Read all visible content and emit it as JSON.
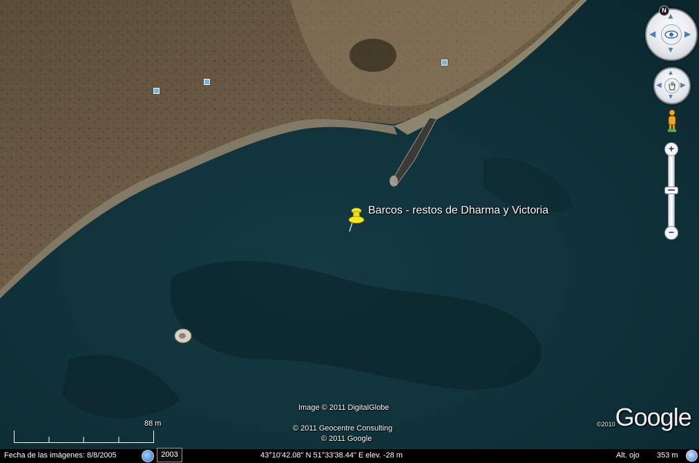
{
  "map": {
    "placemark": {
      "label": "Barcos - restos de Dharma y Victoria",
      "icon": "yellow-pushpin-icon"
    },
    "attribution": {
      "image": "Image © 2011 DigitalGlobe",
      "line1": "© 2011 Geocentre Consulting",
      "line2": "© 2011 Google"
    },
    "logo": {
      "year": "©2010",
      "word": "Google"
    },
    "scale": {
      "label": "88 m"
    }
  },
  "controls": {
    "north_label": "N",
    "zoom_in": "+",
    "zoom_out": "−",
    "icons": [
      "look-joystick-icon",
      "move-joystick-icon",
      "street-view-pegman-icon",
      "zoom-slider-icon"
    ]
  },
  "status": {
    "imagery_date": "Fecha de las imágenes: 8/8/2005",
    "history_year": "2003",
    "coords": "43°10'42.08\" N   51°33'38.44\" E  elev.  -28 m",
    "eye_alt_label": "Alt. ojo",
    "eye_alt_value": "353 m"
  },
  "colors": {
    "water": "#0f2f38",
    "land": "#6b5a44",
    "beach": "#9a8b72",
    "placemark": "#f5e20a"
  }
}
